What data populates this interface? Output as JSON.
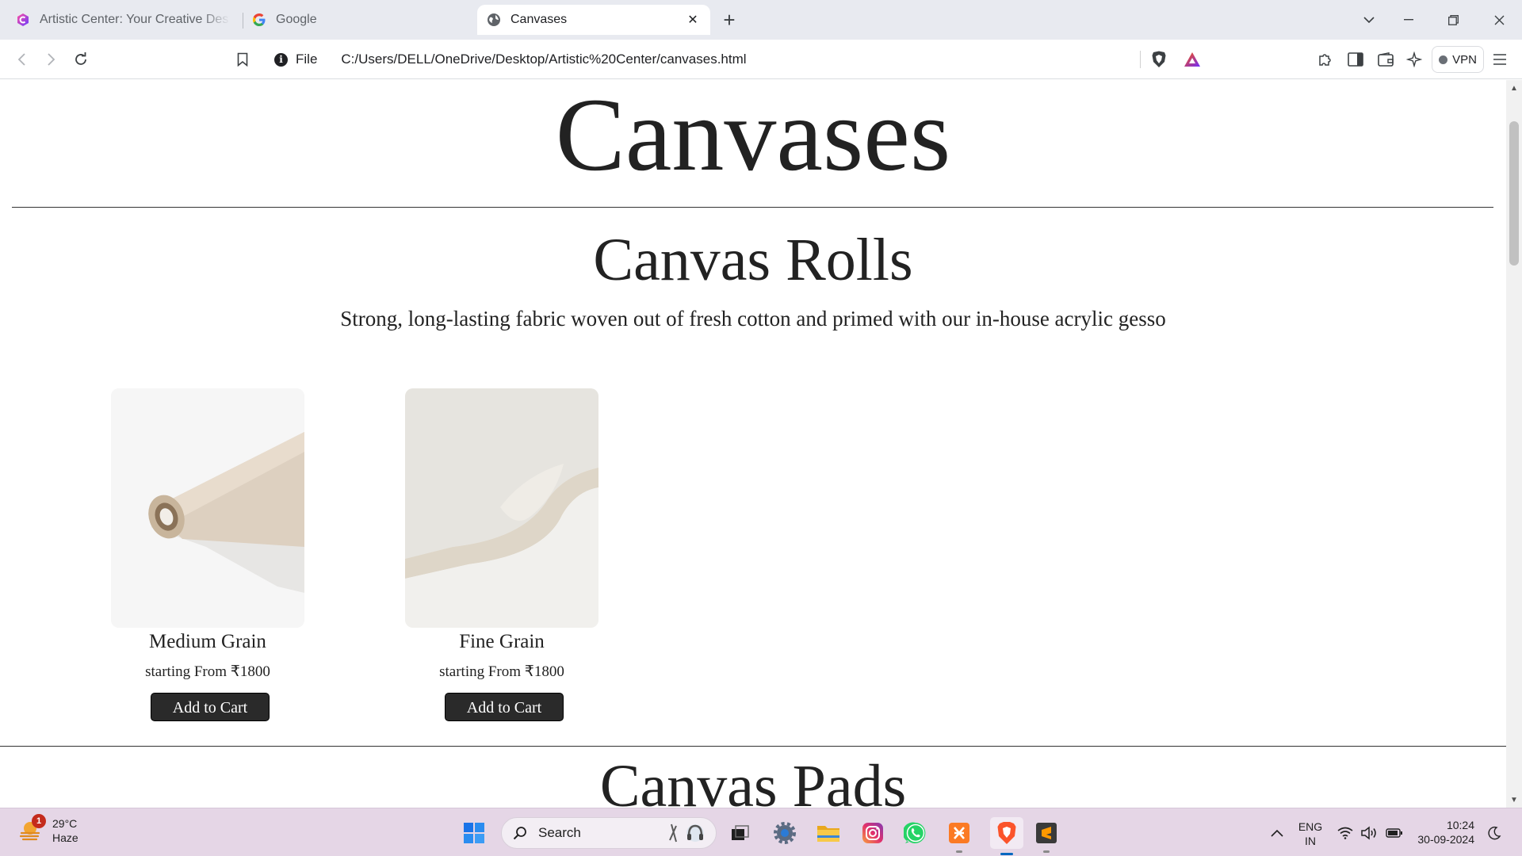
{
  "browser": {
    "tabs": [
      {
        "title": "Artistic Center: Your Creative Destination",
        "favicon": "artistic-center-logo"
      },
      {
        "title": "Google",
        "favicon": "google-g-logo"
      },
      {
        "title": "Canvases",
        "favicon": "globe-icon",
        "active": true
      }
    ],
    "address": {
      "scheme_label": "File",
      "url": "C:/Users/DELL/OneDrive/Desktop/Artistic%20Center/canvases.html"
    },
    "vpn_label": "VPN"
  },
  "page": {
    "title": "Canvases",
    "section": {
      "title": "Canvas Rolls",
      "description": "Strong, long-lasting fabric woven out of fresh cotton and primed with our in-house acrylic gesso",
      "products": [
        {
          "name": "Medium Grain",
          "price": "starting From ₹1800",
          "button": "Add to Cart"
        },
        {
          "name": "Fine Grain",
          "price": "starting From ₹1800",
          "button": "Add to Cart"
        }
      ]
    },
    "next_section_title": "Canvas Pads"
  },
  "taskbar": {
    "weather": {
      "temp": "29°C",
      "condition": "Haze",
      "badge": "1"
    },
    "search_label": "Search",
    "language": {
      "line1": "ENG",
      "line2": "IN"
    },
    "clock": {
      "time": "10:24",
      "date": "30-09-2024"
    }
  }
}
